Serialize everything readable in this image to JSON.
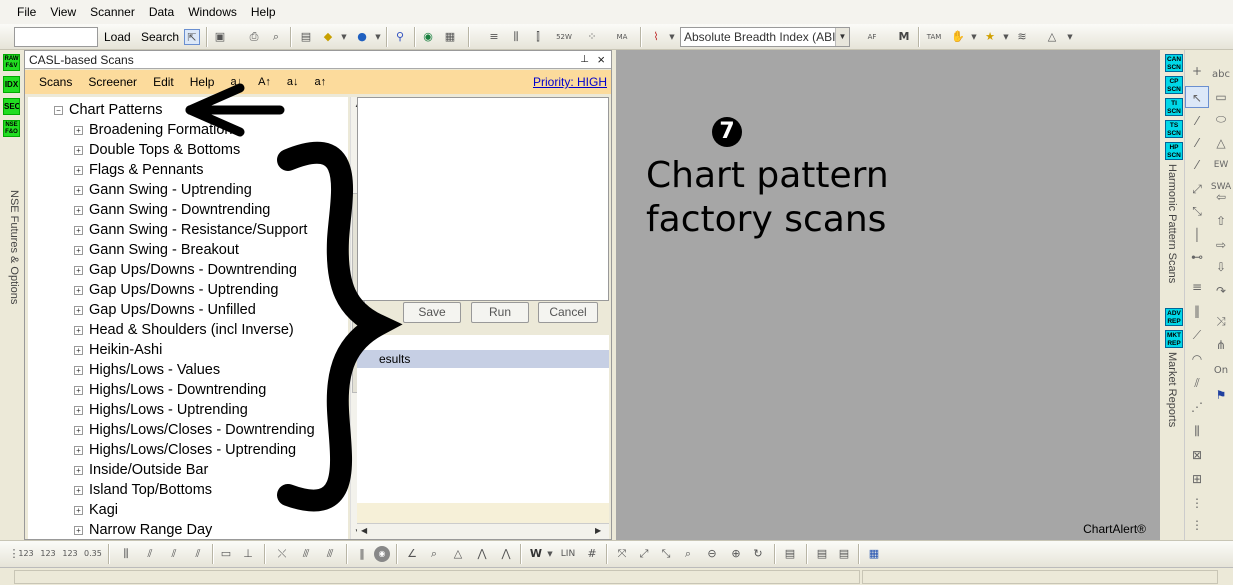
{
  "menubar": {
    "items": [
      "File",
      "View",
      "Scanner",
      "Data",
      "Windows",
      "Help"
    ]
  },
  "toolbar": {
    "load_label": "Load",
    "search_label": "Search",
    "indicator_value": "Absolute Breadth Index (ABI"
  },
  "leftdock": {
    "buttons": [
      "RAW F&V",
      "IDX",
      "SEC",
      "NSE F&O"
    ],
    "label": "NSE Futures & Options"
  },
  "panel": {
    "title": "CASL-based Scans",
    "menu": [
      "Scans",
      "Screener",
      "Edit",
      "Help"
    ],
    "priority": "Priority: HIGH"
  },
  "tree": {
    "root": "Chart Patterns",
    "items": [
      "Broadening Formations",
      "Double Tops & Bottoms",
      "Flags & Pennants",
      "Gann Swing - Uptrending",
      "Gann Swing - Downtrending",
      "Gann Swing - Resistance/Support",
      "Gann Swing - Breakout",
      "Gap Ups/Downs - Downtrending",
      "Gap Ups/Downs - Uptrending",
      "Gap Ups/Downs - Unfilled",
      "Head & Shoulders (incl Inverse)",
      "Heikin-Ashi",
      "Highs/Lows - Values",
      "Highs/Lows - Downtrending",
      "Highs/Lows - Uptrending",
      "Highs/Lows/Closes - Downtrending",
      "Highs/Lows/Closes - Uptrending",
      "Inside/Outside Bar",
      "Island Top/Bottoms",
      "Kagi",
      "Narrow Range Day"
    ]
  },
  "buttons": {
    "save": "Save",
    "run": "Run",
    "cancel": "Cancel"
  },
  "results": {
    "label": "esults"
  },
  "annotation": {
    "number": "7",
    "line1": "Chart pattern",
    "line2": "factory scans"
  },
  "brand": "ChartAlert®",
  "rightstrip": {
    "buttons_top": [
      "CAN SCN",
      "CP SCN",
      "TI SCN",
      "TS SCN",
      "HP SCN"
    ],
    "label_top": "Harmonic Pattern Scans",
    "buttons_bottom": [
      "ADV REP",
      "MKT REP"
    ],
    "label_bottom": "Market Reports"
  },
  "drawstrip": {
    "labels": [
      "abc",
      "SL",
      "EW SWA",
      "SL",
      "SL",
      "On"
    ]
  },
  "bottombar": {
    "lin_label": "LIN"
  }
}
